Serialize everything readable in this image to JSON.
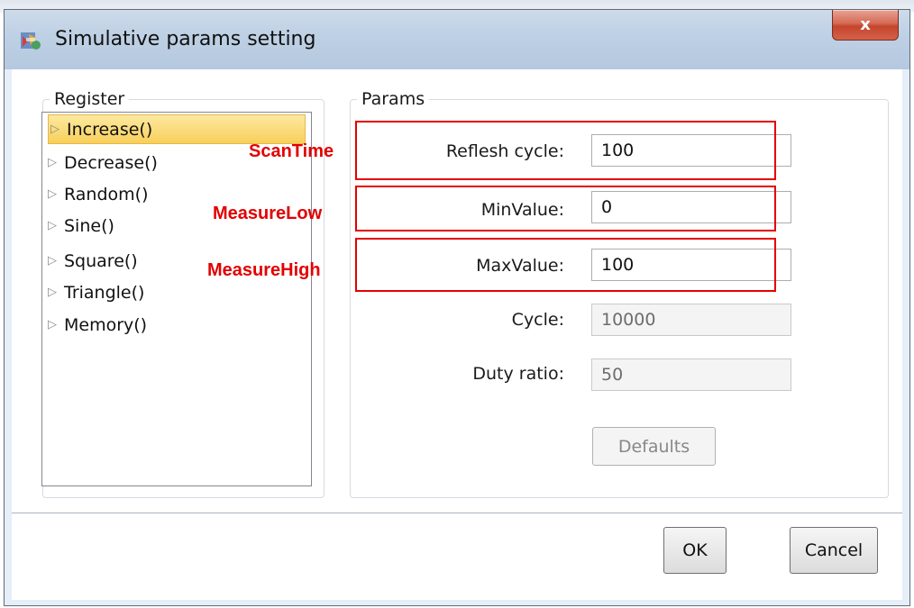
{
  "window": {
    "title": "Simulative params setting",
    "close_label": "x"
  },
  "register": {
    "legend": "Register",
    "items": [
      {
        "label": "Increase()",
        "selected": true
      },
      {
        "label": "Decrease()"
      },
      {
        "label": "Random()"
      },
      {
        "label": "Sine()"
      },
      {
        "label": "Square()"
      },
      {
        "label": "Triangle()"
      },
      {
        "label": "Memory()"
      }
    ]
  },
  "params": {
    "legend": "Params",
    "refresh_cycle": {
      "label": "Reflesh cycle:",
      "value": "100"
    },
    "min_value": {
      "label": "MinValue:",
      "value": "0"
    },
    "max_value": {
      "label": "MaxValue:",
      "value": "100"
    },
    "cycle": {
      "label": "Cycle:",
      "value": "10000",
      "disabled": true
    },
    "duty_ratio": {
      "label": "Duty ratio:",
      "value": "50",
      "disabled": true
    },
    "defaults_label": "Defaults"
  },
  "footer": {
    "ok_label": "OK",
    "cancel_label": "Cancel"
  },
  "annotations": {
    "scan_time": "ScanTime",
    "measure_low": "MeasureLow",
    "measure_high": "MeasureHigh",
    "color": "#e30000"
  },
  "colors": {
    "selection": "#f8cf5a",
    "close_button": "#c5442c"
  }
}
